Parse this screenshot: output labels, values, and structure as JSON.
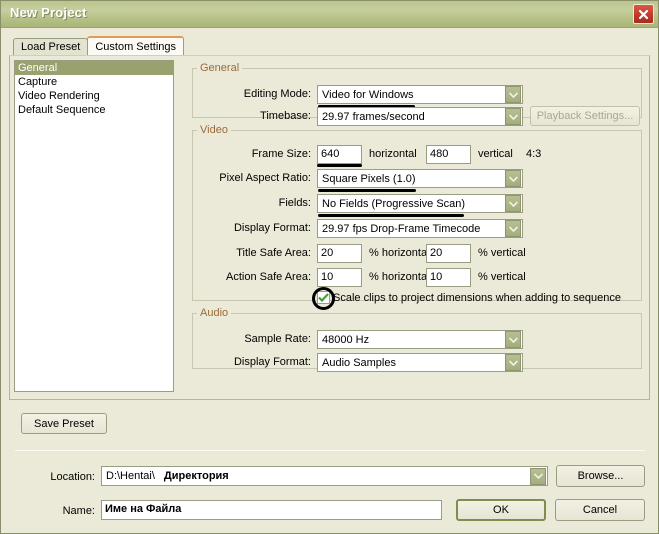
{
  "window": {
    "title": "New Project",
    "close_icon": "close-x-icon"
  },
  "tabs": [
    {
      "label": "Load Preset",
      "active": false
    },
    {
      "label": "Custom Settings",
      "active": true
    }
  ],
  "categories": [
    {
      "label": "General",
      "selected": true
    },
    {
      "label": "Capture",
      "selected": false
    },
    {
      "label": "Video Rendering",
      "selected": false
    },
    {
      "label": "Default Sequence",
      "selected": false
    }
  ],
  "general": {
    "legend": "General",
    "editing_mode": {
      "label": "Editing Mode:",
      "value": "Video for Windows"
    },
    "timebase": {
      "label": "Timebase:",
      "value": "29.97 frames/second"
    },
    "playback_settings": {
      "label": "Playback Settings...",
      "disabled": true
    }
  },
  "video": {
    "legend": "Video",
    "frame_size": {
      "label": "Frame Size:",
      "horizontal_value": "640",
      "horizontal_unit": "horizontal",
      "vertical_value": "480",
      "vertical_unit": "vertical",
      "aspect": "4:3"
    },
    "pixel_aspect_ratio": {
      "label": "Pixel Aspect Ratio:",
      "value": "Square Pixels (1.0)"
    },
    "fields": {
      "label": "Fields:",
      "value": "No Fields (Progressive Scan)"
    },
    "display_format": {
      "label": "Display Format:",
      "value": "29.97 fps Drop-Frame Timecode"
    },
    "title_safe_area": {
      "label": "Title Safe Area:",
      "horizontal_value": "20",
      "horizontal_unit": "% horizontal",
      "vertical_value": "20",
      "vertical_unit": "% vertical"
    },
    "action_safe_area": {
      "label": "Action Safe Area:",
      "horizontal_value": "10",
      "horizontal_unit": "% horizontal",
      "vertical_value": "10",
      "vertical_unit": "% vertical"
    },
    "scale_clips": {
      "label": "Scale clips to project dimensions when adding to sequence",
      "checked": true,
      "check_icon": "checkmark-icon"
    }
  },
  "audio": {
    "legend": "Audio",
    "sample_rate": {
      "label": "Sample Rate:",
      "value": "48000 Hz"
    },
    "display_format": {
      "label": "Display Format:",
      "value": "Audio Samples"
    }
  },
  "bottom": {
    "save_preset": "Save Preset",
    "location_label": "Location:",
    "location_path": "D:\\Hentai\\",
    "location_dir": "Директория",
    "browse": "Browse...",
    "name_label": "Name:",
    "name_value": "Име на Файла",
    "ok": "OK",
    "cancel": "Cancel"
  },
  "annotations": {
    "underline_editing_mode": "black-marker-underline",
    "underline_frame_size": "black-marker-underline",
    "underline_pixel_aspect_ratio": "black-marker-underline",
    "underline_fields": "black-marker-underline",
    "circle_scale_clips": "black-marker-circle"
  },
  "colors": {
    "titlebar": "#b9c48d",
    "accent_tab": "#e59a54",
    "selection": "#99a16e",
    "group_legend": "#9c6b3c",
    "close_button": "#c4392a",
    "annotation": "#000000"
  }
}
